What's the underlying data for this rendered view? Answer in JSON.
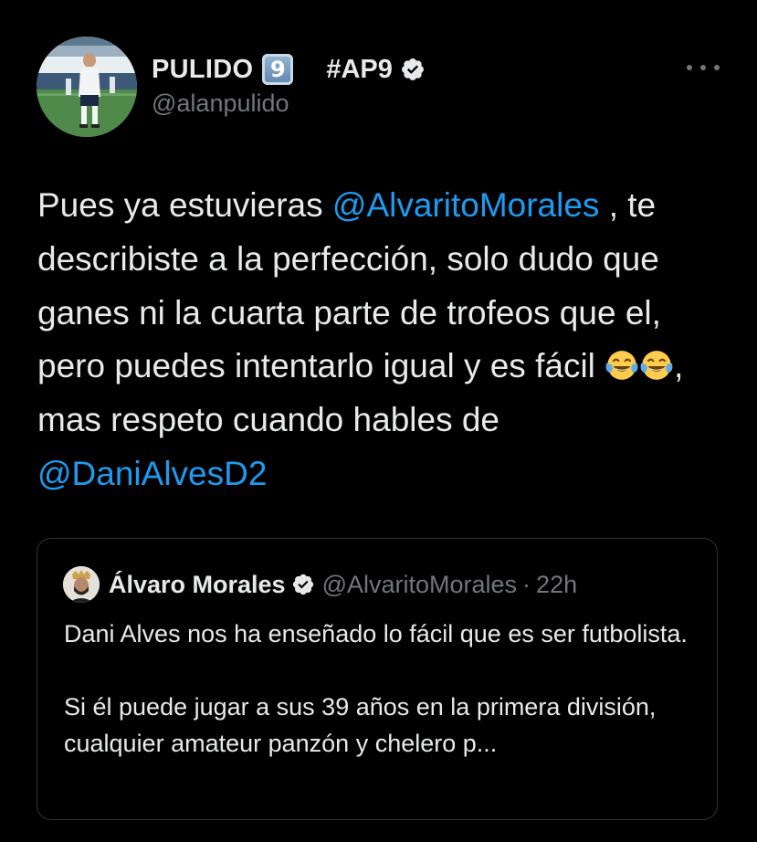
{
  "author": {
    "display_name": "PULIDO",
    "keycap_digit": "9",
    "name_suffix": "#AP9",
    "handle": "@alanpulido"
  },
  "tweet": {
    "text_1": "Pues ya estuvieras ",
    "mention_1": "@AlvaritoMorales",
    "text_2": " , te describiste a la perfección, solo dudo que ganes ni la cuarta parte de trofeos que el, pero puedes intentarlo igual y es fácil ",
    "text_3": ", mas respeto cuando hables de ",
    "mention_2": "@DaniAlvesD2",
    "emoji": "face-with-tears-of-joy"
  },
  "quoted_tweet": {
    "display_name": "Álvaro Morales",
    "handle": "@AlvaritoMorales",
    "separator": "·",
    "time": "22h",
    "text": "Dani Alves nos ha enseñado lo fácil que es ser futbolista.\n\nSi él puede jugar a sus 39 años en la primera división, cualquier amateur panzón y chelero p..."
  },
  "icons": {
    "verified": "verified-badge-icon",
    "more": "more-options-icon"
  },
  "colors": {
    "background": "#000000",
    "text": "#e7e9ea",
    "secondary_text": "#71767b",
    "link": "#1d9bf0",
    "border": "#2f3336"
  }
}
